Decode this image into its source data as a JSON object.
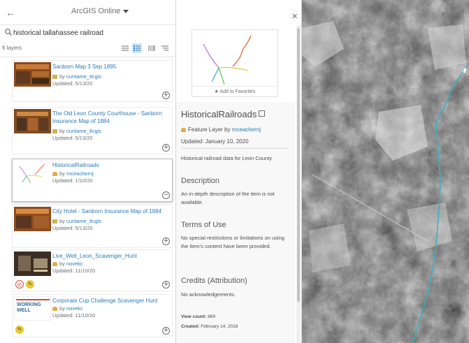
{
  "header": {
    "back_icon": "arrow-left-icon",
    "source_label": "ArcGIS Online"
  },
  "search": {
    "value": "historical tallahassee railroad",
    "icon": "search-icon"
  },
  "toolbar": {
    "count_label": "6 layers",
    "icons": [
      "sort-icon",
      "list-icon",
      "compact-list-icon",
      "filter-icon"
    ]
  },
  "results": [
    {
      "title": "Sanborn Map 3 Sep 1895",
      "by": "by",
      "owner": "curtiame_tlcgis",
      "updated": "Updated: 5/13/20"
    },
    {
      "title": "The Old Leon County Courthouse - Sanborn Insurance Map of 1884",
      "by": "by",
      "owner": "curtiame_tlcgis",
      "updated": "Updated: 5/13/20"
    },
    {
      "title": "HistoricalRailroads",
      "by": "by",
      "owner": "mceachernj",
      "updated": "Updated: 1/10/20"
    },
    {
      "title": "City Hotel - Sanborn Insurance Map of 1884",
      "by": "by",
      "owner": "curtiame_tlcgis",
      "updated": "Updated: 5/13/20"
    },
    {
      "title": "Live_Well_Leon_Scavenger_Hunt",
      "by": "by",
      "owner": "novekc",
      "updated": "Updated: 11/10/20"
    },
    {
      "title": "Corporate Cup Challenge Scavenger Hunt",
      "by": "by",
      "owner": "novekc",
      "updated": "Updated: 11/10/20",
      "thumb_text": "WORKING WELL"
    }
  ],
  "details": {
    "favorite_label": "Add to Favorites",
    "title": "HistoricalRailroads",
    "type_label": "Feature Layer by",
    "owner": "mceachernj",
    "updated": "Updated: January 10, 2020",
    "summary": "Historical railroad data for Leon County",
    "description_heading": "Description",
    "description_text": "An in-depth description of the item is not available.",
    "terms_heading": "Terms of Use",
    "terms_text": "No special restrictions or limitations on using the item's content have been provided.",
    "credits_heading": "Credits (Attribution)",
    "credits_text": "No acknowledgements.",
    "view_count_label": "View count:",
    "view_count_value": "869",
    "created_label": "Created:",
    "created_value": "February 14, 2018"
  },
  "colors": {
    "link": "#2b7bb9",
    "railroad_line": "#2fb3c4"
  }
}
